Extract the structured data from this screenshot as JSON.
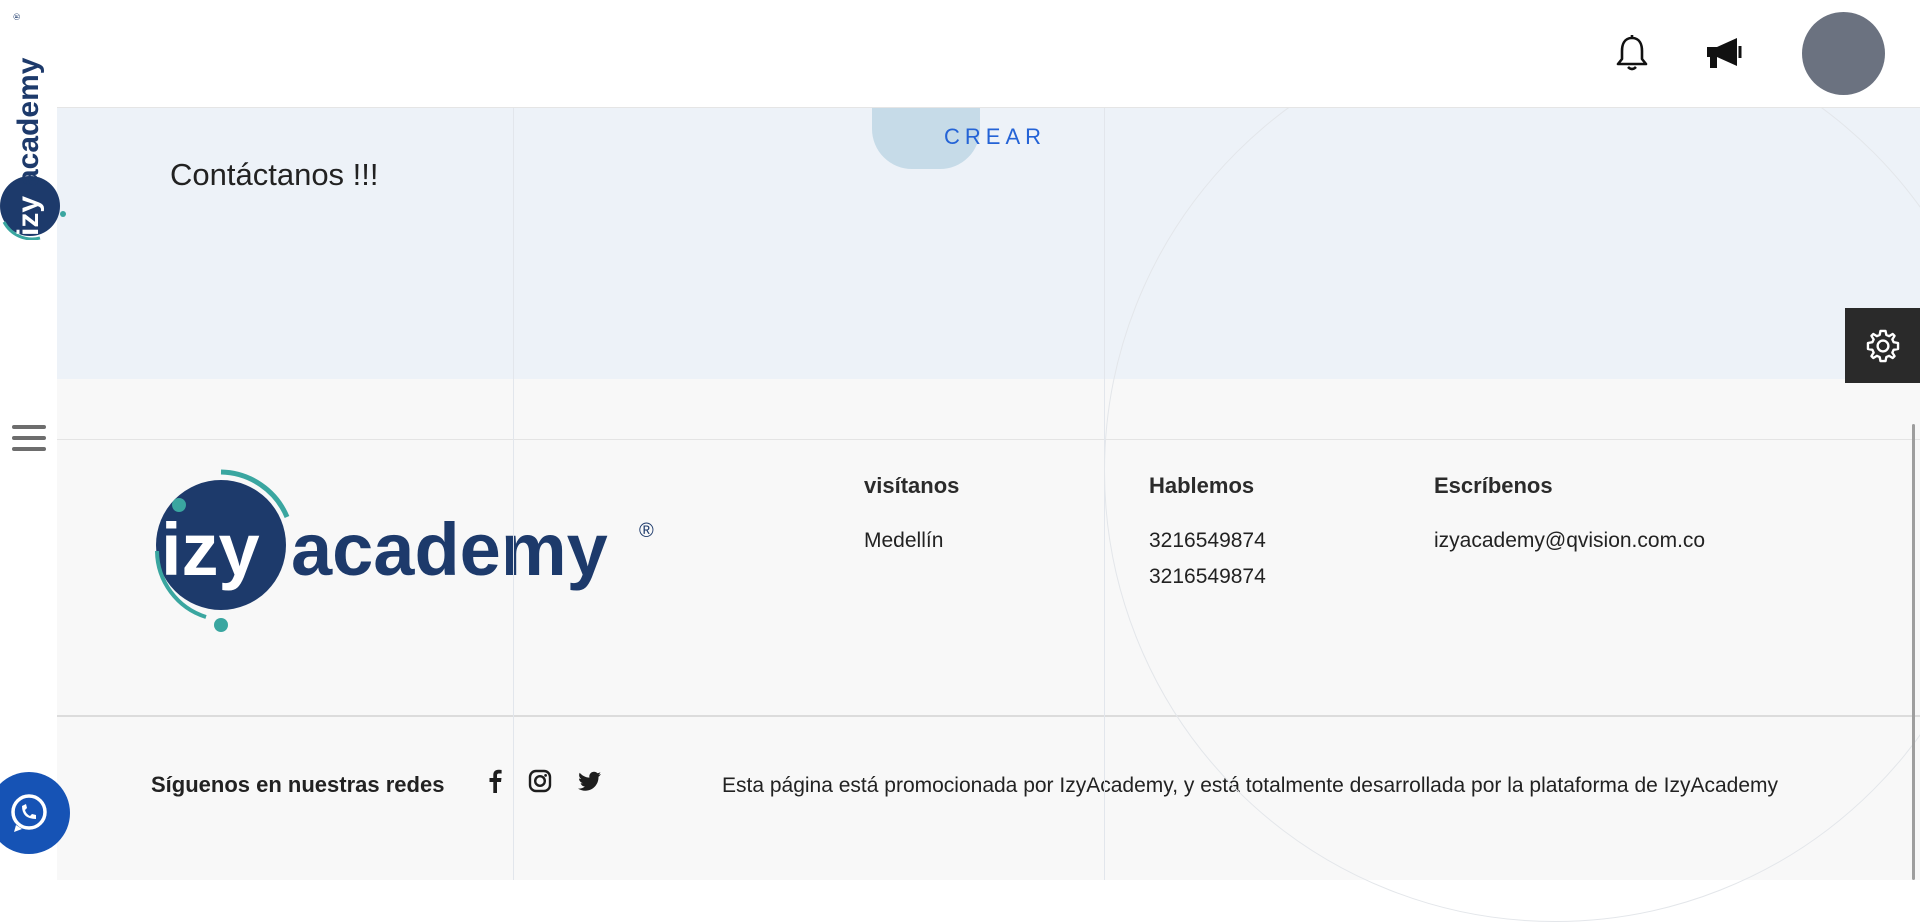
{
  "brand": {
    "name": "izyacademy",
    "registered_mark": "®",
    "logo_prefix": "izy",
    "logo_suffix": "academy"
  },
  "topbar": {
    "notifications_icon": "bell-icon",
    "announcements_icon": "megaphone-icon",
    "avatar_color": "#6b7280"
  },
  "contact_band": {
    "title": "Contáctanos !!!",
    "create_button_label": "CREAR"
  },
  "footer": {
    "columns": [
      {
        "heading": "visítanos",
        "lines": [
          "Medellín"
        ]
      },
      {
        "heading": "Hablemos",
        "lines": [
          "3216549874",
          "3216549874"
        ]
      },
      {
        "heading": "Escríbenos",
        "lines": [
          "izyacademy@qvision.com.co"
        ]
      }
    ],
    "follow_label": "Síguenos en nuestras redes",
    "social_icons": [
      "facebook-icon",
      "instagram-icon",
      "twitter-icon"
    ],
    "promo_text": "Esta página está promocionada por IzyAcademy, y está totalmente desarrollada por la plataforma de IzyAcademy"
  },
  "colors": {
    "brand_navy": "#1d3a6b",
    "brand_teal": "#3aa6a0",
    "accent_blue": "#2463d6",
    "whatsapp_blue": "#1653b5",
    "band_bg": "#edf2f8"
  }
}
